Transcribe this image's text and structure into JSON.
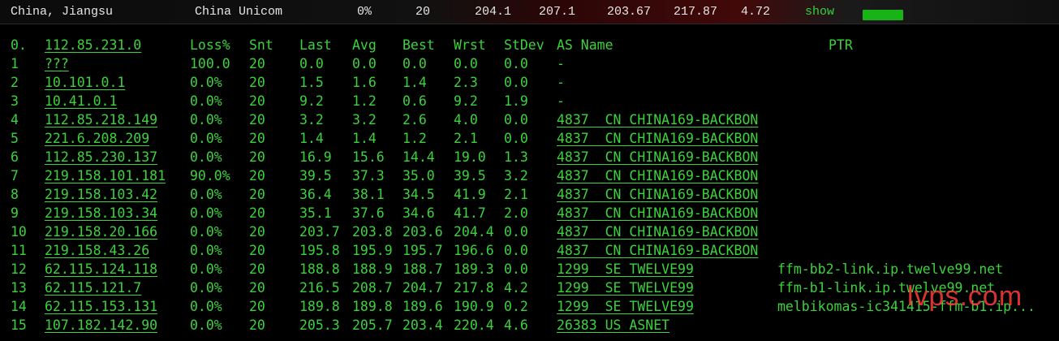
{
  "summary": {
    "location": "China, Jiangsu",
    "isp": "China Unicom",
    "loss": "0%",
    "sent": "20",
    "last": "204.1",
    "avg": "207.1",
    "best": "203.67",
    "worst": "217.87",
    "stdev": "4.72",
    "show_label": "show",
    "colors": {
      "text": "#e6e6e6",
      "show": "#33d13a",
      "highlight": "#420909"
    }
  },
  "table": {
    "host_label": "0.",
    "host": "112.85.231.0",
    "headers": [
      "Loss%",
      "Snt",
      "Last",
      "Avg",
      "Best",
      "Wrst",
      "StDev",
      "AS Name",
      "PTR"
    ],
    "rows": [
      {
        "n": "1",
        "ip": "???",
        "loss": "100.0",
        "snt": "20",
        "last": "0.0",
        "avg": "0.0",
        "best": "0.0",
        "wrst": "0.0",
        "stdev": "0.0",
        "as": "-",
        "ptr": ""
      },
      {
        "n": "2",
        "ip": "10.101.0.1",
        "loss": "0.0%",
        "snt": "20",
        "last": "1.5",
        "avg": "1.6",
        "best": "1.4",
        "wrst": "2.3",
        "stdev": "0.0",
        "as": "-",
        "ptr": ""
      },
      {
        "n": "3",
        "ip": "10.41.0.1",
        "loss": "0.0%",
        "snt": "20",
        "last": "9.2",
        "avg": "1.2",
        "best": "0.6",
        "wrst": "9.2",
        "stdev": "1.9",
        "as": "-",
        "ptr": ""
      },
      {
        "n": "4",
        "ip": "112.85.218.149",
        "loss": "0.0%",
        "snt": "20",
        "last": "3.2",
        "avg": "3.2",
        "best": "2.6",
        "wrst": "4.0",
        "stdev": "0.0",
        "as": "4837  CN CHINA169-BACKBON",
        "ptr": ""
      },
      {
        "n": "5",
        "ip": "221.6.208.209",
        "loss": "0.0%",
        "snt": "20",
        "last": "1.4",
        "avg": "1.4",
        "best": "1.2",
        "wrst": "2.1",
        "stdev": "0.0",
        "as": "4837  CN CHINA169-BACKBON",
        "ptr": ""
      },
      {
        "n": "6",
        "ip": "112.85.230.137",
        "loss": "0.0%",
        "snt": "20",
        "last": "16.9",
        "avg": "15.6",
        "best": "14.4",
        "wrst": "19.0",
        "stdev": "1.3",
        "as": "4837  CN CHINA169-BACKBON",
        "ptr": ""
      },
      {
        "n": "7",
        "ip": "219.158.101.181",
        "loss": "90.0%",
        "snt": "20",
        "last": "39.5",
        "avg": "37.3",
        "best": "35.0",
        "wrst": "39.5",
        "stdev": "3.2",
        "as": "4837  CN CHINA169-BACKBON",
        "ptr": ""
      },
      {
        "n": "8",
        "ip": "219.158.103.42",
        "loss": "0.0%",
        "snt": "20",
        "last": "36.4",
        "avg": "38.1",
        "best": "34.5",
        "wrst": "41.9",
        "stdev": "2.1",
        "as": "4837  CN CHINA169-BACKBON",
        "ptr": ""
      },
      {
        "n": "9",
        "ip": "219.158.103.34",
        "loss": "0.0%",
        "snt": "20",
        "last": "35.1",
        "avg": "37.6",
        "best": "34.6",
        "wrst": "41.7",
        "stdev": "2.0",
        "as": "4837  CN CHINA169-BACKBON",
        "ptr": ""
      },
      {
        "n": "10",
        "ip": "219.158.20.166",
        "loss": "0.0%",
        "snt": "20",
        "last": "203.7",
        "avg": "203.8",
        "best": "203.6",
        "wrst": "204.4",
        "stdev": "0.0",
        "as": "4837  CN CHINA169-BACKBON",
        "ptr": ""
      },
      {
        "n": "11",
        "ip": "219.158.43.26",
        "loss": "0.0%",
        "snt": "20",
        "last": "195.8",
        "avg": "195.9",
        "best": "195.7",
        "wrst": "196.6",
        "stdev": "0.0",
        "as": "4837  CN CHINA169-BACKBON",
        "ptr": ""
      },
      {
        "n": "12",
        "ip": "62.115.124.118",
        "loss": "0.0%",
        "snt": "20",
        "last": "188.8",
        "avg": "188.9",
        "best": "188.7",
        "wrst": "189.3",
        "stdev": "0.0",
        "as": "1299  SE TWELVE99",
        "ptr": "ffm-bb2-link.ip.twelve99.net"
      },
      {
        "n": "13",
        "ip": "62.115.121.7",
        "loss": "0.0%",
        "snt": "20",
        "last": "216.5",
        "avg": "208.7",
        "best": "204.7",
        "wrst": "217.8",
        "stdev": "4.2",
        "as": "1299  SE TWELVE99",
        "ptr": "ffm-b1-link.ip.twelve99.net"
      },
      {
        "n": "14",
        "ip": "62.115.153.131",
        "loss": "0.0%",
        "snt": "20",
        "last": "189.8",
        "avg": "189.8",
        "best": "189.6",
        "wrst": "190.9",
        "stdev": "0.2",
        "as": "1299  SE TWELVE99",
        "ptr": "melbikomas-ic341415-ffm-b1.ip..."
      },
      {
        "n": "15",
        "ip": "107.182.142.90",
        "loss": "0.0%",
        "snt": "20",
        "last": "205.3",
        "avg": "205.7",
        "best": "203.4",
        "wrst": "220.4",
        "stdev": "4.6",
        "as": "26383 US ASNET",
        "ptr": ""
      }
    ],
    "text_color": "#3bd23b"
  },
  "watermark": "lvps.com"
}
